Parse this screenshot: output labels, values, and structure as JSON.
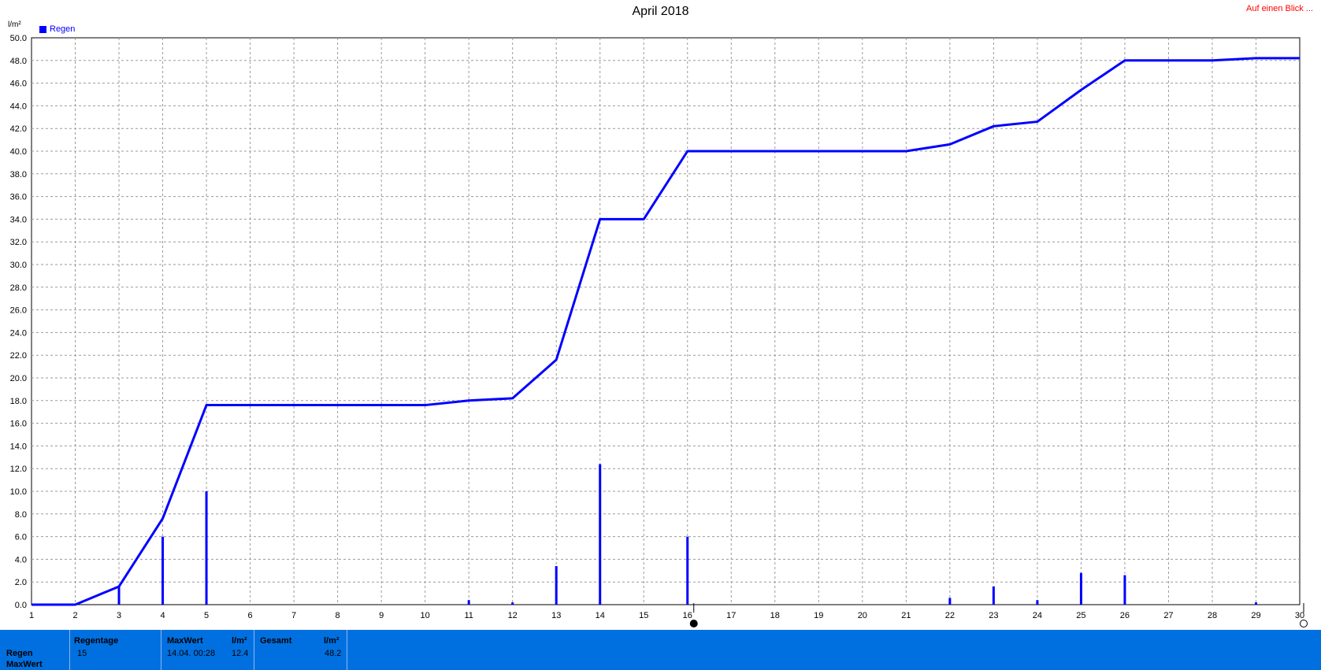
{
  "title": "April 2018",
  "link_label": "Auf einen Blick ...",
  "y_unit": "l/m²",
  "legend_label": "Regen",
  "colors": {
    "series": "#0000ff",
    "footer": "#0070e0",
    "link": "#ff0000"
  },
  "footer": {
    "row1_label": "Regen",
    "row2_label": "MaxWert",
    "regentage_header": "Regentage",
    "regentage_value": "15",
    "maxwert_header": "MaxWert",
    "maxwert_unit": "l/m²",
    "maxwert_time": "14.04.  00:28",
    "maxwert_value": "12.4",
    "gesamt_header": "Gesamt",
    "gesamt_unit": "l/m²",
    "gesamt_value": "48.2"
  },
  "chart_data": {
    "type": "line",
    "title": "April 2018",
    "ylabel": "l/m²",
    "xlim": [
      1,
      30
    ],
    "ylim": [
      0,
      50
    ],
    "grid": true,
    "legend_placement": "top-left",
    "x_ticks": [
      1,
      2,
      3,
      4,
      5,
      6,
      7,
      8,
      9,
      10,
      11,
      12,
      13,
      14,
      15,
      16,
      17,
      18,
      19,
      20,
      21,
      22,
      23,
      24,
      25,
      26,
      27,
      28,
      29,
      30
    ],
    "y_ticks": [
      0,
      2,
      4,
      6,
      8,
      10,
      12,
      14,
      16,
      18,
      20,
      22,
      24,
      26,
      28,
      30,
      32,
      34,
      36,
      38,
      40,
      42,
      44,
      46,
      48,
      50
    ],
    "series": [
      {
        "name": "Regen",
        "kind": "cumulative-line",
        "x": [
          1,
          2,
          3,
          4,
          5,
          10,
          11,
          12,
          13,
          14,
          15,
          16,
          21,
          22,
          23,
          24,
          25,
          26,
          28,
          29,
          30
        ],
        "values": [
          0,
          0,
          1.6,
          7.6,
          17.6,
          17.6,
          18.0,
          18.2,
          21.6,
          34.0,
          34.0,
          40.0,
          40.0,
          40.6,
          42.2,
          42.6,
          45.4,
          48.0,
          48.0,
          48.2,
          48.2
        ]
      },
      {
        "name": "",
        "kind": "daily-bars",
        "x": [
          3,
          4,
          5,
          11,
          12,
          13,
          14,
          16,
          22,
          23,
          24,
          25,
          26,
          29
        ],
        "values": [
          1.6,
          6.0,
          10.0,
          0.4,
          0.2,
          3.4,
          12.4,
          6.0,
          0.6,
          1.6,
          0.4,
          2.8,
          2.6,
          0.2
        ]
      }
    ]
  }
}
